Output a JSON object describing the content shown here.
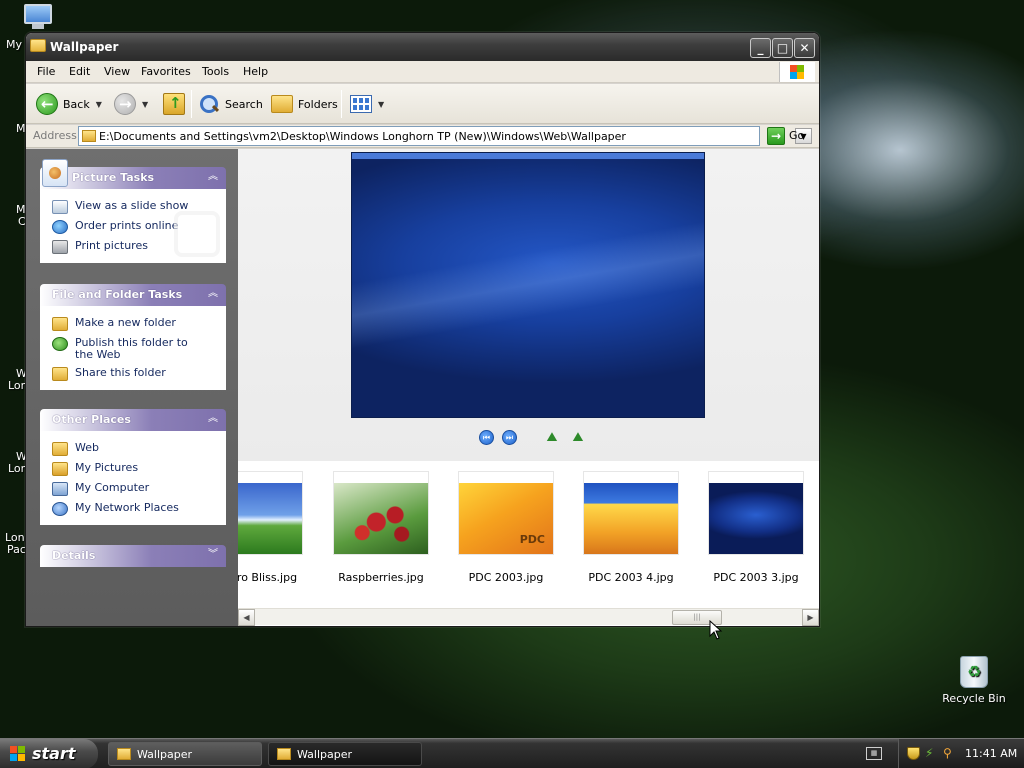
{
  "desktop": {
    "left_labels": [
      "My",
      "M",
      "M",
      "C",
      "W",
      "Lon",
      "W",
      "Lon",
      "Lon",
      "Pac"
    ],
    "recycle_bin_label": "Recycle Bin"
  },
  "window": {
    "title": "Wallpaper",
    "menu": [
      "File",
      "Edit",
      "View",
      "Favorites",
      "Tools",
      "Help"
    ],
    "toolbar": {
      "back_label": "Back",
      "search_label": "Search",
      "folders_label": "Folders"
    },
    "address": {
      "label": "Address",
      "value": "E:\\Documents and Settings\\vm2\\Desktop\\Windows Longhorn TP (New)\\Windows\\Web\\Wallpaper",
      "go_label": "Go"
    },
    "taskpane": {
      "picture_tasks": {
        "title": "Picture Tasks",
        "items": [
          "View as a slide show",
          "Order prints online",
          "Print pictures"
        ]
      },
      "file_folder_tasks": {
        "title": "File and Folder Tasks",
        "items": [
          "Make a new folder",
          "Publish this folder to the Web",
          "Share this folder"
        ]
      },
      "other_places": {
        "title": "Other Places",
        "items": [
          "Web",
          "My Pictures",
          "My Computer",
          "My Network Places"
        ]
      },
      "details": {
        "title": "Details"
      }
    },
    "thumbnails": [
      {
        "caption": "ro Bliss.jpg"
      },
      {
        "caption": "Raspberries.jpg"
      },
      {
        "caption": "PDC 2003.jpg"
      },
      {
        "caption": "PDC 2003 4.jpg"
      },
      {
        "caption": "PDC 2003 3.jpg"
      }
    ]
  },
  "taskbar": {
    "start_label": "start",
    "tasks": [
      "Wallpaper",
      "Wallpaper"
    ],
    "clock": "11:41 AM"
  },
  "colors": {
    "panel_header": "#7e71ad",
    "link_text": "#14285e",
    "preview_blue": "#173f9e"
  }
}
